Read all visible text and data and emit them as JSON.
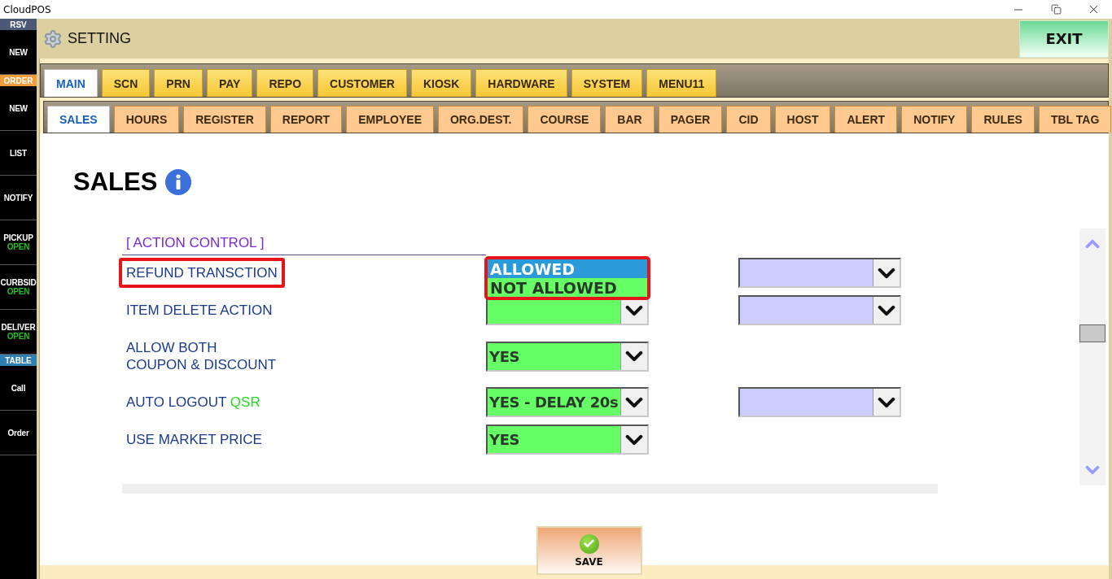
{
  "window": {
    "title": "CloudPOS"
  },
  "sidebar": [
    {
      "kind": "header",
      "label": "RSV",
      "color": "#4b5876"
    },
    {
      "kind": "button",
      "label": "NEW"
    },
    {
      "kind": "header",
      "label": "ORDER",
      "color": "#f39c3a"
    },
    {
      "kind": "button",
      "label": "NEW"
    },
    {
      "kind": "button",
      "label": "LIST"
    },
    {
      "kind": "button",
      "label": "NOTIFY"
    },
    {
      "kind": "button",
      "label": "PICKUP",
      "status": "OPEN"
    },
    {
      "kind": "button",
      "label": "CURBSID",
      "status": "OPEN"
    },
    {
      "kind": "button",
      "label": "DELIVER",
      "status": "OPEN"
    },
    {
      "kind": "header",
      "label": "TABLE",
      "color": "#2f7fb2"
    },
    {
      "kind": "button",
      "label": "Call"
    },
    {
      "kind": "button",
      "label": "Order"
    }
  ],
  "header": {
    "title": "SETTING",
    "exit_button": "EXIT"
  },
  "tabs": [
    {
      "label": "MAIN",
      "selected": true
    },
    {
      "label": "SCN",
      "selected": false
    },
    {
      "label": "PRN",
      "selected": false
    },
    {
      "label": "PAY",
      "selected": false
    },
    {
      "label": "REPO",
      "selected": false
    },
    {
      "label": "CUSTOMER",
      "selected": false
    },
    {
      "label": "KIOSK",
      "selected": false
    },
    {
      "label": "HARDWARE",
      "selected": false
    },
    {
      "label": "SYSTEM",
      "selected": false
    },
    {
      "label": "MENU11",
      "selected": false
    }
  ],
  "subtabs": [
    {
      "label": "SALES",
      "selected": true
    },
    {
      "label": "HOURS",
      "selected": false
    },
    {
      "label": "REGISTER",
      "selected": false
    },
    {
      "label": "REPORT",
      "selected": false
    },
    {
      "label": "EMPLOYEE",
      "selected": false
    },
    {
      "label": "ORG.DEST.",
      "selected": false
    },
    {
      "label": "COURSE",
      "selected": false
    },
    {
      "label": "BAR",
      "selected": false
    },
    {
      "label": "PAGER",
      "selected": false
    },
    {
      "label": "CID",
      "selected": false
    },
    {
      "label": "HOST",
      "selected": false
    },
    {
      "label": "ALERT",
      "selected": false
    },
    {
      "label": "NOTIFY",
      "selected": false
    },
    {
      "label": "RULES",
      "selected": false
    },
    {
      "label": "TBL TAG",
      "selected": false
    }
  ],
  "page": {
    "title": "SALES",
    "section_heading": "[ ACTION CONTROL ]",
    "rows": [
      {
        "label": [
          "REFUND TRANSCTION"
        ],
        "label_highlighted": true,
        "second_select": true,
        "open_list": {
          "highlighted": true,
          "options": [
            {
              "label": "ALLOWED",
              "selected": true
            },
            {
              "label": "NOT ALLOWED",
              "selected": false
            }
          ]
        }
      },
      {
        "label": [
          "ITEM DELETE ACTION"
        ],
        "label_highlighted": false,
        "second_select": true
      },
      {
        "label": [
          "ALLOW BOTH",
          "COUPON & DISCOUNT"
        ],
        "label_highlighted": false,
        "value": "YES",
        "second_select": false
      },
      {
        "label": [
          "AUTO LOGOUT"
        ],
        "tag": "QSR",
        "label_highlighted": false,
        "value": "YES - DELAY 20s",
        "second_select": true
      },
      {
        "label": [
          "USE MARKET PRICE"
        ],
        "label_highlighted": false,
        "value": "YES",
        "second_select": false
      }
    ]
  },
  "save_button": "SAVE"
}
